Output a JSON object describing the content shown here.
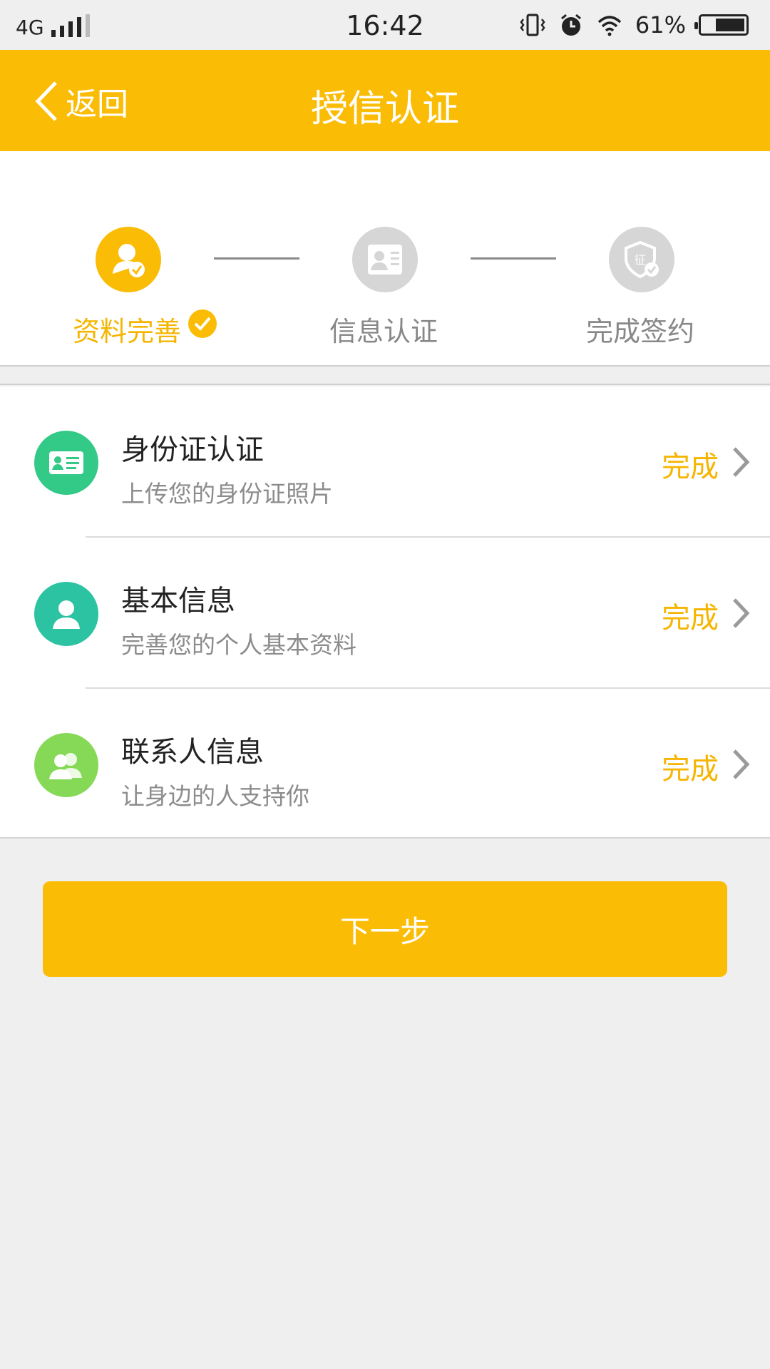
{
  "status_bar": {
    "network": "4G",
    "time": "16:42",
    "battery_percent": "61%",
    "signal_bars": 4
  },
  "header": {
    "back_label": "返回",
    "title": "授信认证",
    "background_color": "#fbbc05"
  },
  "steps": [
    {
      "label": "资料完善",
      "state": "active",
      "completed": true,
      "icon": "user-check-icon"
    },
    {
      "label": "信息认证",
      "state": "inactive",
      "completed": false,
      "icon": "id-card-icon"
    },
    {
      "label": "完成签约",
      "state": "inactive",
      "completed": false,
      "icon": "shield-seal-icon"
    }
  ],
  "list": [
    {
      "title": "身份证认证",
      "subtitle": "上传您的身份证照片",
      "status": "完成",
      "icon": "id-card-icon",
      "icon_color": "#33c986"
    },
    {
      "title": "基本信息",
      "subtitle": "完善您的个人基本资料",
      "status": "完成",
      "icon": "person-icon",
      "icon_color": "#2cc3a2"
    },
    {
      "title": "联系人信息",
      "subtitle": "让身边的人支持你",
      "status": "完成",
      "icon": "contacts-icon",
      "icon_color": "#86d957"
    }
  ],
  "next_button": {
    "label": "下一步"
  },
  "colors": {
    "accent": "#fbbc05",
    "status_text": "#f5b500"
  }
}
